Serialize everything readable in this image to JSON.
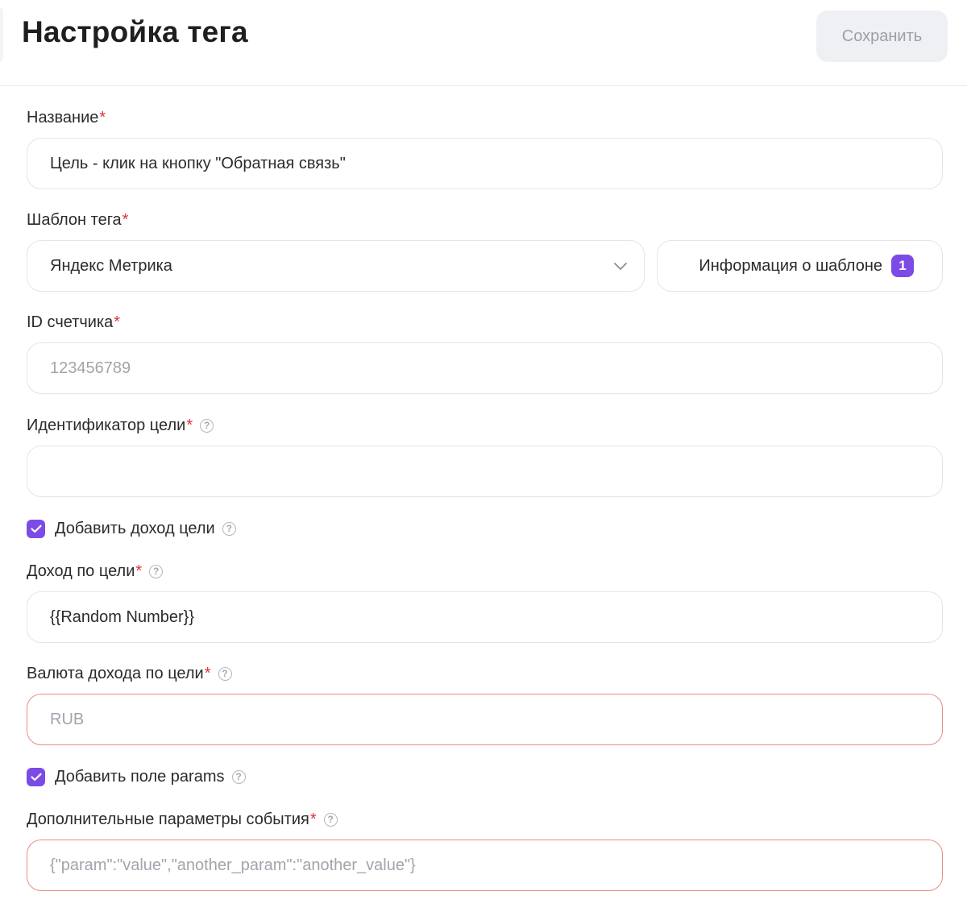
{
  "header": {
    "title": "Настройка тега",
    "save_label": "Сохранить"
  },
  "form": {
    "name": {
      "label": "Название",
      "required_mark": "*",
      "value": "Цель - клик на кнопку \"Обратная связь\""
    },
    "template": {
      "label": "Шаблон тега",
      "required_mark": "*",
      "selected": "Яндекс Метрика",
      "info_button": "Информация о шаблоне",
      "info_badge": "1"
    },
    "counter_id": {
      "label": "ID счетчика",
      "required_mark": "*",
      "placeholder": "123456789"
    },
    "goal_id": {
      "label": "Идентификатор цели",
      "required_mark": "*",
      "value": ""
    },
    "add_goal_revenue": {
      "label": "Добавить доход цели",
      "checked": true
    },
    "goal_revenue": {
      "label": "Доход по цели",
      "required_mark": "*",
      "value": "{{Random Number}}"
    },
    "revenue_currency": {
      "label": "Валюта дохода по цели",
      "required_mark": "*",
      "placeholder": "RUB",
      "state": "error"
    },
    "add_params": {
      "label": "Добавить поле params",
      "checked": true
    },
    "event_params": {
      "label": "Дополнительные параметры события",
      "required_mark": "*",
      "placeholder": "{\"param\":\"value\",\"another_param\":\"another_value\"}",
      "state": "error"
    }
  },
  "icons": {
    "help": "?",
    "chevron": "chevron-down-icon",
    "checkmark": "checkmark-icon"
  },
  "colors": {
    "accent": "#7c4be6",
    "required": "#e0323c",
    "error_border": "#ee8a85"
  }
}
